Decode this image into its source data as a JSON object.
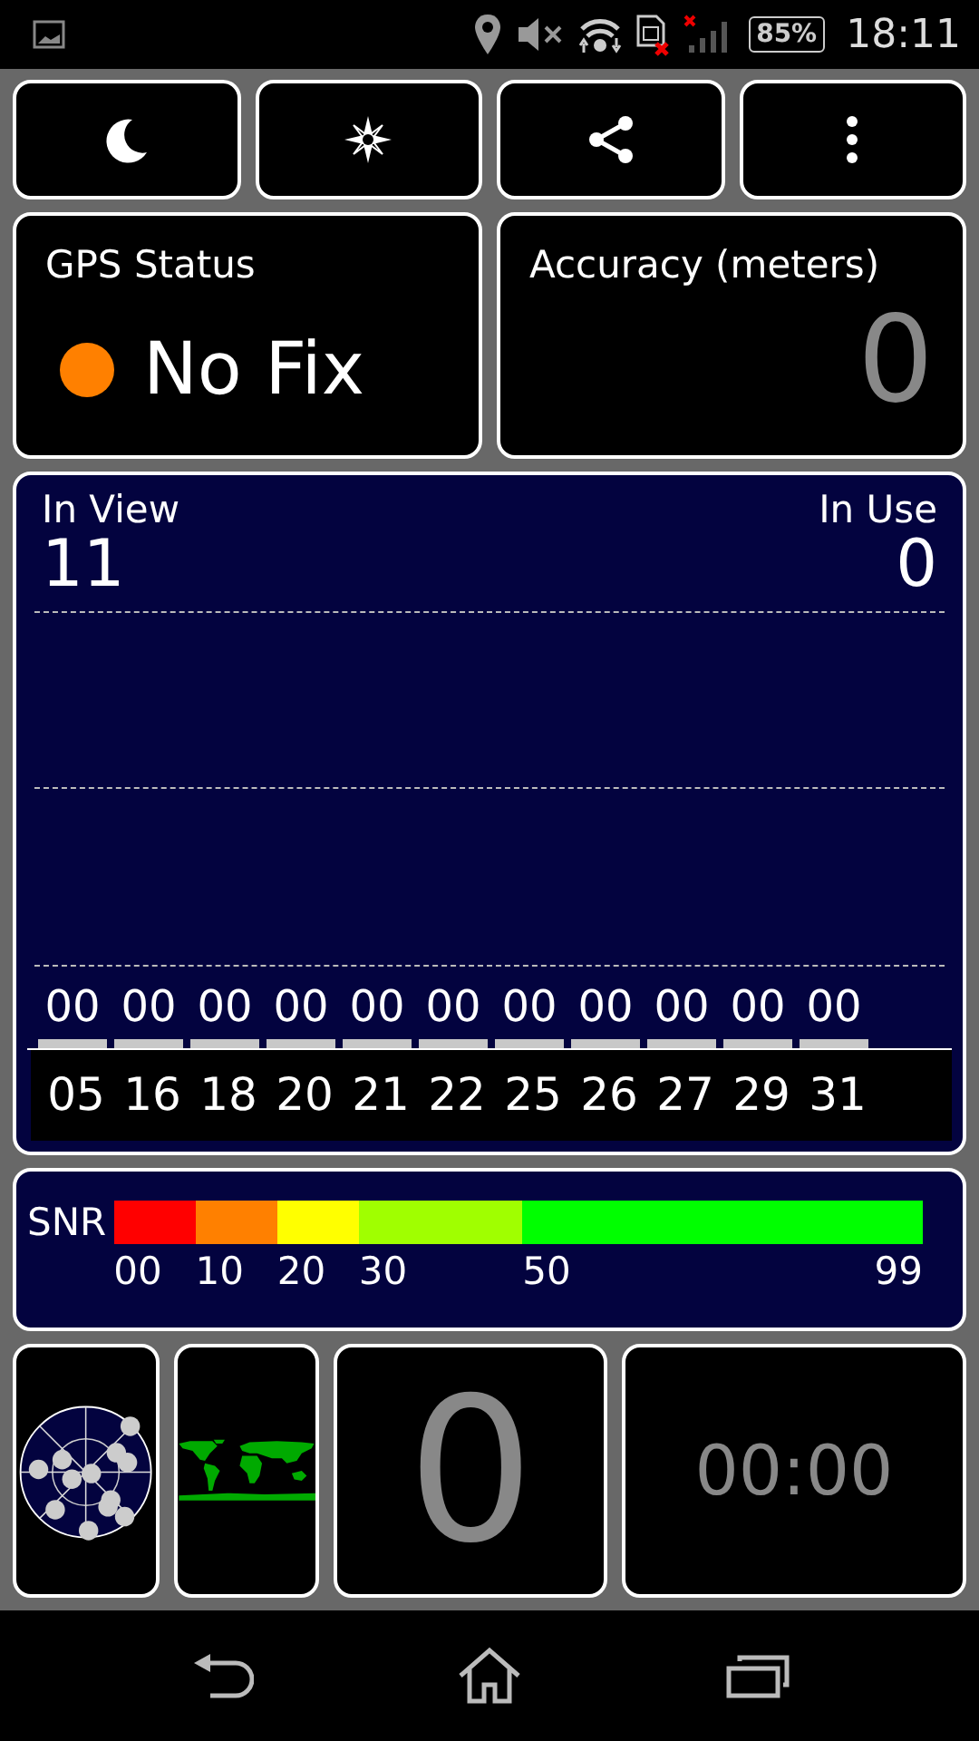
{
  "status_bar": {
    "battery": "85%",
    "time": "18:11"
  },
  "gps_status": {
    "label": "GPS Status",
    "value": "No Fix",
    "color": "#ff8000"
  },
  "accuracy": {
    "label": "Accuracy (meters)",
    "value": "0"
  },
  "satellites": {
    "in_view_label": "In View",
    "in_view": "11",
    "in_use_label": "In Use",
    "in_use": "0",
    "items": [
      {
        "snr": "00",
        "prn": "05"
      },
      {
        "snr": "00",
        "prn": "16"
      },
      {
        "snr": "00",
        "prn": "18"
      },
      {
        "snr": "00",
        "prn": "20"
      },
      {
        "snr": "00",
        "prn": "21"
      },
      {
        "snr": "00",
        "prn": "22"
      },
      {
        "snr": "00",
        "prn": "25"
      },
      {
        "snr": "00",
        "prn": "26"
      },
      {
        "snr": "00",
        "prn": "27"
      },
      {
        "snr": "00",
        "prn": "29"
      },
      {
        "snr": "00",
        "prn": "31"
      }
    ]
  },
  "snr_scale": {
    "label": "SNR",
    "segments": [
      {
        "label": "00",
        "color": "#ff0000"
      },
      {
        "label": "10",
        "color": "#ff8000"
      },
      {
        "label": "20",
        "color": "#ffff00"
      },
      {
        "label": "30",
        "color": "#a0ff00"
      },
      {
        "label": "50",
        "color": "#00ff00"
      }
    ],
    "end_label": "99"
  },
  "tiles": {
    "satellite_count": "0",
    "timer": "00:00"
  }
}
